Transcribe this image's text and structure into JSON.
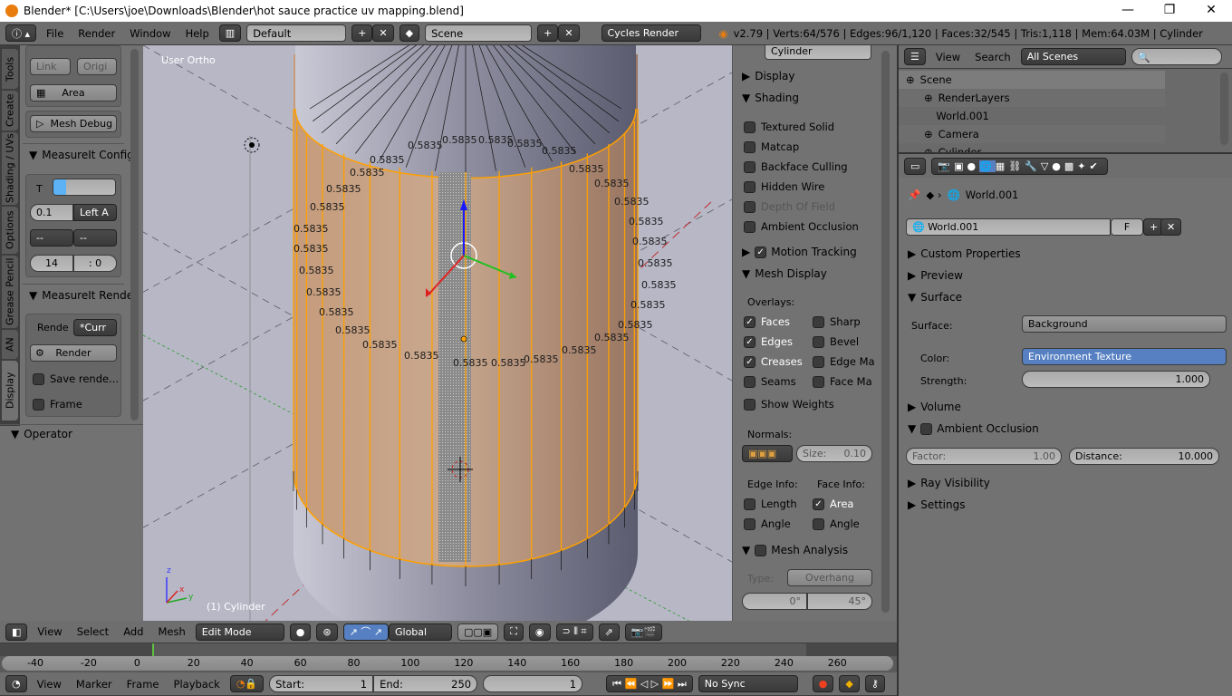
{
  "window": {
    "title": "Blender* [C:\\Users\\joe\\Downloads\\Blender\\hot sauce practice uv mapping.blend]",
    "minimize": "—",
    "maximize": "❐",
    "close": "✕"
  },
  "info_header": {
    "menus": [
      "File",
      "Render",
      "Window",
      "Help"
    ],
    "layout": "Default",
    "scene": "Scene",
    "engine": "Cycles Render",
    "stats": "v2.79 | Verts:64/576 | Edges:96/1,120 | Faces:32/545 | Tris:1,118 | Mem:64.03M | Cylinder"
  },
  "toolshelf": {
    "tabs": [
      "Tools",
      "Create",
      "Shading / UVs",
      "Options",
      "Grease Pencil",
      "AN",
      "Display"
    ],
    "active_tab": "Display",
    "link": "Link",
    "origin": "Origi",
    "area": "Area",
    "mesh_debug": "Mesh Debug",
    "config": {
      "title": "MeasureIt Config",
      "t_label": "T",
      "value": "0.1",
      "align": "Left A",
      "dd1": "--",
      "dd2": "--",
      "num1": "14",
      "num2": ": 0"
    },
    "render": {
      "title": "MeasureIt Rende",
      "rende_label": "Rende",
      "rende_value": "*Curr",
      "render_btn": "Render",
      "save": "Save rende...",
      "frame": "Frame"
    },
    "operator": "Operator"
  },
  "viewport": {
    "view_label": "User Ortho",
    "object_label": "(1) Cylinder",
    "measure_value": "0.5835",
    "axes": {
      "x": "x",
      "y": "y",
      "z": "z"
    }
  },
  "npanel": {
    "object_name": "Cylinder",
    "display": "Display",
    "shading": "Shading",
    "shading_items": [
      {
        "label": "Textured Solid",
        "checked": false
      },
      {
        "label": "Matcap",
        "checked": false
      },
      {
        "label": "Backface Culling",
        "checked": false
      },
      {
        "label": "Hidden Wire",
        "checked": false
      },
      {
        "label": "Depth Of Field",
        "checked": false,
        "disabled": true
      },
      {
        "label": "Ambient Occlusion",
        "checked": false
      }
    ],
    "motion_tracking": "Motion Tracking",
    "mesh_display": "Mesh Display",
    "overlays": "Overlays:",
    "overlay_items": [
      {
        "label": "Faces",
        "checked": true
      },
      {
        "label": "Sharp",
        "checked": false
      },
      {
        "label": "Edges",
        "checked": true
      },
      {
        "label": "Bevel",
        "checked": false
      },
      {
        "label": "Creases",
        "checked": true
      },
      {
        "label": "Edge Ma",
        "checked": false
      },
      {
        "label": "Seams",
        "checked": false
      },
      {
        "label": "Face Ma",
        "checked": false
      }
    ],
    "show_weights": "Show Weights",
    "normals": "Normals:",
    "size": "Size:",
    "size_value": "0.10",
    "edge_info": "Edge Info:",
    "face_info": "Face Info:",
    "length": "Length",
    "area": "Area",
    "angle": "Angle",
    "angle2": "Angle",
    "mesh_analysis": "Mesh Analysis",
    "type_label": "Type:",
    "type_value": "Overhang",
    "min": "0°",
    "max": "45°"
  },
  "header3d": {
    "menus": [
      "View",
      "Select",
      "Add",
      "Mesh"
    ],
    "mode": "Edit Mode",
    "orientation": "Global"
  },
  "timeline": {
    "ticks": [
      "-40",
      "-20",
      "0",
      "20",
      "40",
      "60",
      "80",
      "100",
      "120",
      "140",
      "160",
      "180",
      "200",
      "220",
      "240",
      "260"
    ],
    "current_frame": 0,
    "menus": [
      "View",
      "Marker",
      "Frame",
      "Playback"
    ],
    "start_label": "Start:",
    "start": "1",
    "end_label": "End:",
    "end": "250",
    "frame": "1",
    "sync": "No Sync"
  },
  "outliner": {
    "view": "View",
    "search": "Search",
    "filter": "All Scenes",
    "items": [
      {
        "label": "Scene"
      },
      {
        "label": "RenderLayers"
      },
      {
        "label": "World.001"
      },
      {
        "label": "Camera"
      },
      {
        "label": "Cylinder"
      }
    ]
  },
  "properties": {
    "breadcrumb": "World.001",
    "world_name": "World.001",
    "fake_user": "F",
    "panels": {
      "custom": "Custom Properties",
      "preview": "Preview",
      "surface": "Surface",
      "volume": "Volume",
      "ao": "Ambient Occlusion",
      "ray": "Ray Visibility",
      "settings": "Settings"
    },
    "surface_label": "Surface:",
    "surface_value": "Background",
    "color_label": "Color:",
    "color_value": "Environment Texture",
    "strength_label": "Strength:",
    "strength_value": "1.000",
    "factor_label": "Factor:",
    "factor_value": "1.00",
    "distance_label": "Distance:",
    "distance_value": "10.000"
  },
  "colors": {
    "accent_blue": "#5680c2",
    "selection_orange": "#ffa000",
    "viewport_bg": "#b7b7c6"
  }
}
